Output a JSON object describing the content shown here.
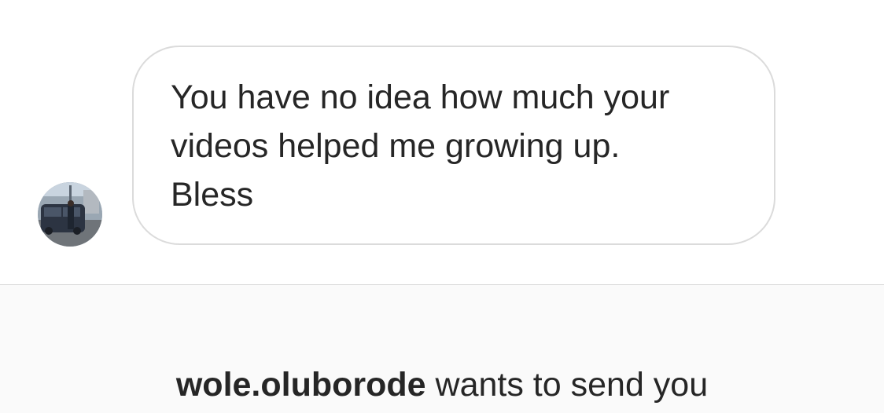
{
  "conversation": {
    "messages": [
      {
        "sender": "other",
        "text": "You have no idea how much your\nvideos helped me growing up.\nBless"
      }
    ]
  },
  "request": {
    "username": "wole.oluborode",
    "text": " wants to send you"
  },
  "icons": {
    "avatar": "profile-photo-avatar"
  },
  "colors": {
    "bubble_border": "#dbdbdb",
    "panel_background": "#fafafa",
    "text": "#262626"
  }
}
